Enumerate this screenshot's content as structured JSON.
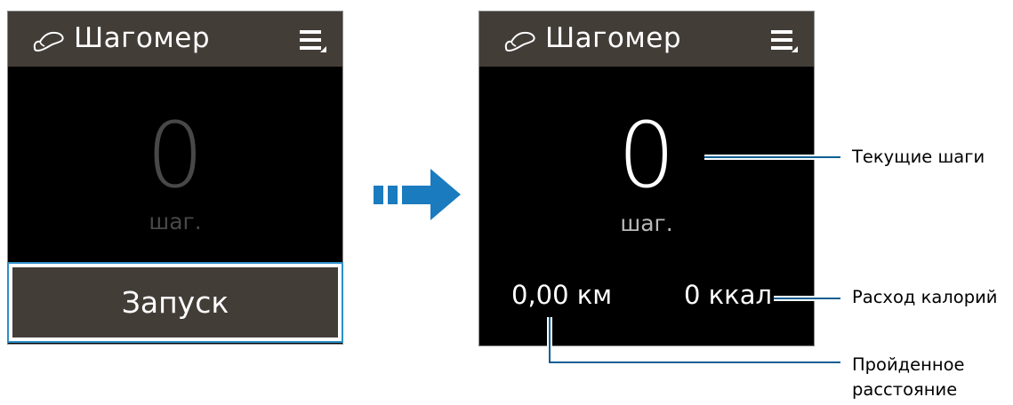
{
  "app": {
    "title": "Шагомер",
    "header_bg": "#433d38",
    "icons": {
      "app": "shoe-icon",
      "menu": "menu-icon"
    }
  },
  "left_screen": {
    "step_count": "0",
    "step_unit": "шаг.",
    "start_button": "Запуск"
  },
  "right_screen": {
    "step_count": "0",
    "step_unit": "шаг.",
    "distance": "0,00 км",
    "calories": "0 ккал"
  },
  "callouts": {
    "current_steps": "Текущие шаги",
    "calories_burned": "Расход калорий",
    "distance_line1": "Пройденное",
    "distance_line2": "расстояние"
  },
  "colors": {
    "accent": "#2e8fc9",
    "arrow": "#1a7bbf"
  }
}
